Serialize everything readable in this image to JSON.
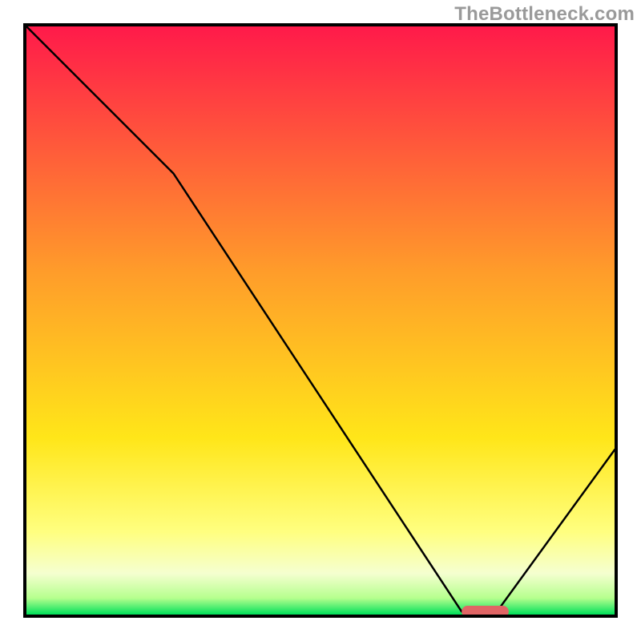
{
  "watermark": "TheBottleneck.com",
  "chart_data": {
    "type": "line",
    "title": "",
    "xlabel": "",
    "ylabel": "",
    "xlim": [
      0,
      100
    ],
    "ylim": [
      0,
      100
    ],
    "grid": false,
    "series": [
      {
        "name": "bottleneck-curve",
        "x": [
          0,
          25,
          74,
          80,
          100
        ],
        "y": [
          100,
          75,
          0.5,
          0.5,
          28
        ],
        "color": "#000000"
      }
    ],
    "marker": {
      "name": "optimal-range-marker",
      "x_range": [
        74,
        82
      ],
      "y": 0.5,
      "color": "#e06565"
    },
    "background_gradient": {
      "stops": [
        {
          "pos": 0.0,
          "color": "#ff1a4a"
        },
        {
          "pos": 0.42,
          "color": "#ff9d2a"
        },
        {
          "pos": 0.7,
          "color": "#ffe619"
        },
        {
          "pos": 0.86,
          "color": "#ffff80"
        },
        {
          "pos": 0.93,
          "color": "#f5ffd0"
        },
        {
          "pos": 0.972,
          "color": "#b6ff8e"
        },
        {
          "pos": 1.0,
          "color": "#00e05a"
        }
      ]
    }
  }
}
